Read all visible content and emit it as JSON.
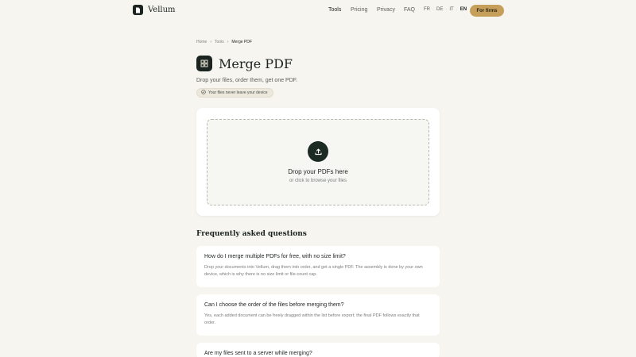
{
  "brand": {
    "name": "Vellum"
  },
  "nav": {
    "tools": "Tools",
    "pricing": "Pricing",
    "privacy": "Privacy",
    "faq": "FAQ"
  },
  "languages": [
    "FR",
    "DE",
    "IT",
    "EN"
  ],
  "active_language": "EN",
  "cta": "For firms",
  "breadcrumb": [
    "Home",
    "Tools",
    "Merge PDF"
  ],
  "page": {
    "title": "Merge PDF",
    "subtitle": "Drop your files, order them, get one PDF.",
    "privacy_badge": "Your files never leave your device"
  },
  "dropzone": {
    "title": "Drop your PDFs here",
    "subtitle": "or click to browse your files"
  },
  "faq": {
    "heading": "Frequently asked questions",
    "items": [
      {
        "question": "How do I merge multiple PDFs for free, with no size limit?",
        "answer": "Drop your documents into Vellum, drag them into order, and get a single PDF. The assembly is done by your own device, which is why there is no size limit or file-count cap."
      },
      {
        "question": "Can I choose the order of the files before merging them?",
        "answer": "Yes, each added document can be freely dragged within the list before export; the final PDF follows exactly that order."
      },
      {
        "question": "Are my files sent to a server while merging?",
        "answer": ""
      }
    ]
  },
  "colors": {
    "background": "#f7f5f0",
    "primary_dark": "#1b2420",
    "accent": "#c6a05a"
  }
}
